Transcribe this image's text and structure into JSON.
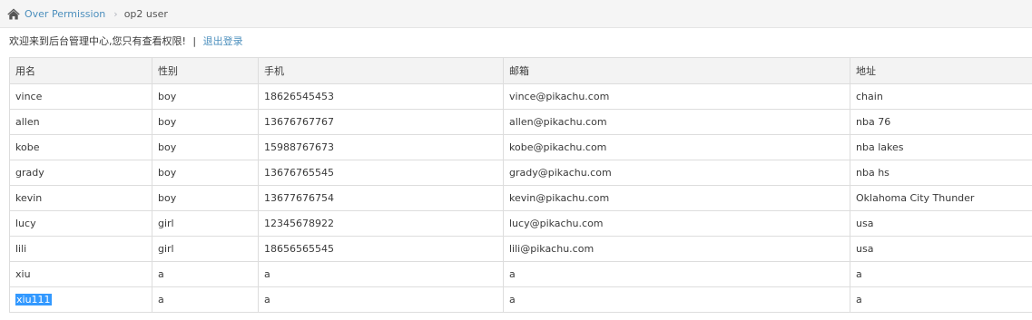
{
  "breadcrumb": {
    "home_icon": "home-icon",
    "parent": "Over Permission",
    "current": "op2 user"
  },
  "welcome": {
    "message": "欢迎来到后台管理中心,您只有查看权限!",
    "separator": "|",
    "logout": "退出登录"
  },
  "table": {
    "headers": [
      "用名",
      "性别",
      "手机",
      "邮箱",
      "地址"
    ],
    "rows": [
      [
        "vince",
        "boy",
        "18626545453",
        "vince@pikachu.com",
        "chain"
      ],
      [
        "allen",
        "boy",
        "13676767767",
        "allen@pikachu.com",
        "nba 76"
      ],
      [
        "kobe",
        "boy",
        "15988767673",
        "kobe@pikachu.com",
        "nba lakes"
      ],
      [
        "grady",
        "boy",
        "13676765545",
        "grady@pikachu.com",
        "nba hs"
      ],
      [
        "kevin",
        "boy",
        "13677676754",
        "kevin@pikachu.com",
        "Oklahoma City Thunder"
      ],
      [
        "lucy",
        "girl",
        "12345678922",
        "lucy@pikachu.com",
        "usa"
      ],
      [
        "lili",
        "girl",
        "18656565545",
        "lili@pikachu.com",
        "usa"
      ],
      [
        "xiu",
        "a",
        "a",
        "a",
        "a"
      ],
      [
        "xiu111",
        "a",
        "a",
        "a",
        "a"
      ]
    ]
  },
  "colors": {
    "link": "#4c8fbd",
    "selection": "#3399ff",
    "header_bg": "#f3f3f3",
    "border": "#dddddd"
  }
}
